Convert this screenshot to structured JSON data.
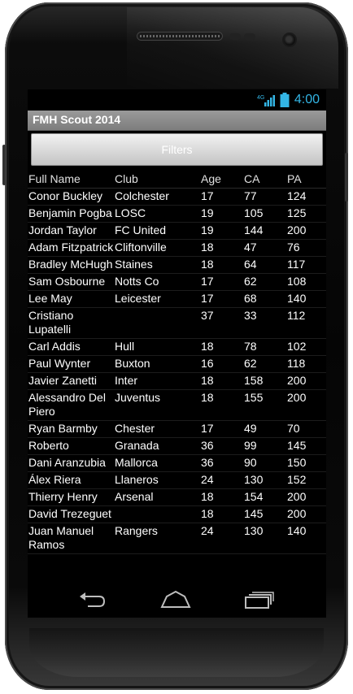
{
  "status": {
    "time": "4:00",
    "network_label": "4G"
  },
  "app": {
    "title": "FMH Scout 2014"
  },
  "filters": {
    "label": "Filters"
  },
  "table": {
    "headers": {
      "name": "Full Name",
      "club": "Club",
      "age": "Age",
      "ca": "CA",
      "pa": "PA"
    },
    "rows": [
      {
        "name": "Conor Buckley",
        "club": "Colchester",
        "age": "17",
        "ca": "77",
        "pa": "124"
      },
      {
        "name": "Benjamin Pogba",
        "club": "LOSC",
        "age": "19",
        "ca": "105",
        "pa": "125"
      },
      {
        "name": "Jordan Taylor",
        "club": "FC United",
        "age": "19",
        "ca": "144",
        "pa": "200"
      },
      {
        "name": "Adam Fitzpatrick",
        "club": "Cliftonville",
        "age": "18",
        "ca": "47",
        "pa": "76"
      },
      {
        "name": "Bradley McHugh",
        "club": "Staines",
        "age": "18",
        "ca": "64",
        "pa": "117"
      },
      {
        "name": "Sam Osbourne",
        "club": "Notts Co",
        "age": "17",
        "ca": "62",
        "pa": "108"
      },
      {
        "name": "Lee May",
        "club": "Leicester",
        "age": "17",
        "ca": "68",
        "pa": "140"
      },
      {
        "name": "Cristiano Lupatelli",
        "club": "",
        "age": "37",
        "ca": "33",
        "pa": "112"
      },
      {
        "name": "Carl Addis",
        "club": "Hull",
        "age": "18",
        "ca": "78",
        "pa": "102"
      },
      {
        "name": "Paul Wynter",
        "club": "Buxton",
        "age": "16",
        "ca": "62",
        "pa": "118"
      },
      {
        "name": "Javier Zanetti",
        "club": "Inter",
        "age": "18",
        "ca": "158",
        "pa": "200"
      },
      {
        "name": "Alessandro Del Piero",
        "club": "Juventus",
        "age": "18",
        "ca": "155",
        "pa": "200"
      },
      {
        "name": "Ryan Barmby",
        "club": "Chester",
        "age": "17",
        "ca": "49",
        "pa": "70"
      },
      {
        "name": "Roberto",
        "club": "Granada",
        "age": "36",
        "ca": "99",
        "pa": "145"
      },
      {
        "name": "Dani Aranzubia",
        "club": "Mallorca",
        "age": "36",
        "ca": "90",
        "pa": "150"
      },
      {
        "name": "Álex Riera",
        "club": "Llaneros",
        "age": "24",
        "ca": "130",
        "pa": "152"
      },
      {
        "name": "Thierry Henry",
        "club": "Arsenal",
        "age": "18",
        "ca": "154",
        "pa": "200"
      },
      {
        "name": "David Trezeguet",
        "club": "",
        "age": "18",
        "ca": "145",
        "pa": "200"
      },
      {
        "name": "Juan Manuel Ramos",
        "club": "Rangers",
        "age": "24",
        "ca": "130",
        "pa": "140"
      }
    ]
  },
  "navbar": {
    "back_icon": "back-icon",
    "home_icon": "home-icon",
    "recents_icon": "recent-apps-icon"
  },
  "colors": {
    "accent": "#33b5e5",
    "titlebar": "#8a8a8a",
    "screen_bg": "#000000"
  }
}
